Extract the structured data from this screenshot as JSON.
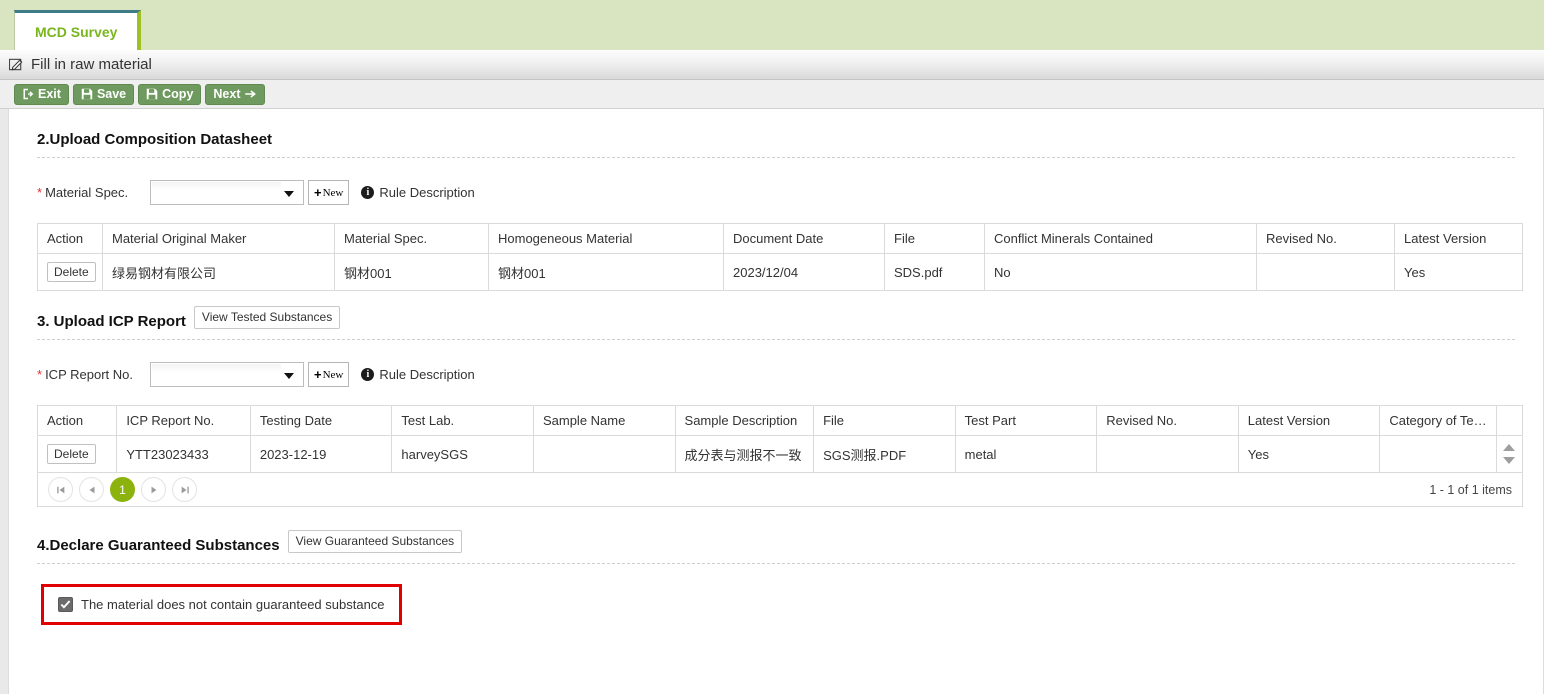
{
  "tab": {
    "label": "MCD Survey"
  },
  "titlebar": {
    "icon": "pencil-edit-icon",
    "title": "Fill in raw material"
  },
  "toolbar": {
    "buttons": [
      {
        "label": "Exit",
        "icon": "exit-icon"
      },
      {
        "label": "Save",
        "icon": "save-disk-icon"
      },
      {
        "label": "Copy",
        "icon": "copy-disk-icon"
      },
      {
        "label": "Next",
        "icon": "arrow-right-icon"
      }
    ]
  },
  "section2": {
    "heading": "2.Upload Composition Datasheet",
    "field": {
      "label": "Material Spec.",
      "required_mark": "*",
      "select_value": "",
      "new_button": "New",
      "rule_description": "Rule Description"
    },
    "table": {
      "columns": [
        "Action",
        "Material Original Maker",
        "Material Spec.",
        "Homogeneous Material",
        "Document Date",
        "File",
        "Conflict Minerals Contained",
        "Revised No.",
        "Latest Version"
      ],
      "rows": [
        {
          "action": "Delete",
          "maker": "绿易钢材有限公司",
          "spec": "钢材001",
          "homogeneous": "钢材001",
          "document_date": "2023/12/04",
          "file": "SDS.pdf",
          "conflict_minerals": "No",
          "revised_no": "",
          "latest_version": "Yes"
        }
      ]
    }
  },
  "section3": {
    "heading": "3. Upload ICP Report",
    "view_button": "View Tested Substances",
    "field": {
      "label": "ICP Report No.",
      "required_mark": "*",
      "select_value": "",
      "new_button": "New",
      "rule_description": "Rule Description"
    },
    "table": {
      "columns": [
        "Action",
        "ICP Report No.",
        "Testing Date",
        "Test Lab.",
        "Sample Name",
        "Sample Description",
        "File",
        "Test Part",
        "Revised No.",
        "Latest Version",
        "Category of Tested I..."
      ],
      "rows": [
        {
          "action": "Delete",
          "report_no": "YTT23023433",
          "testing_date": "2023-12-19",
          "test_lab": "harveySGS",
          "sample_name": "",
          "sample_description": "成分表与测报不一致",
          "file": "SGS测报.PDF",
          "test_part": "metal",
          "revised_no": "",
          "latest_version": "Yes",
          "category": ""
        }
      ]
    },
    "pager": {
      "first": "first-page-icon",
      "prev": "prev-page-icon",
      "current_page": "1",
      "next": "next-page-icon",
      "last": "last-page-icon",
      "count_label": "1 - 1 of 1 items"
    }
  },
  "section4": {
    "heading": "4.Declare Guaranteed Substances",
    "view_button": "View Guaranteed Substances",
    "checkbox": {
      "checked": true,
      "label": "The material does not contain guaranteed substance"
    }
  },
  "colors": {
    "tab_bg": "#d9e5c0",
    "tab_text": "#7ab51d",
    "button_green": "#6f9a5f",
    "link_blue": "#3b7bbf",
    "pager_active": "#8cb30d",
    "highlight_red": "#e00000"
  }
}
